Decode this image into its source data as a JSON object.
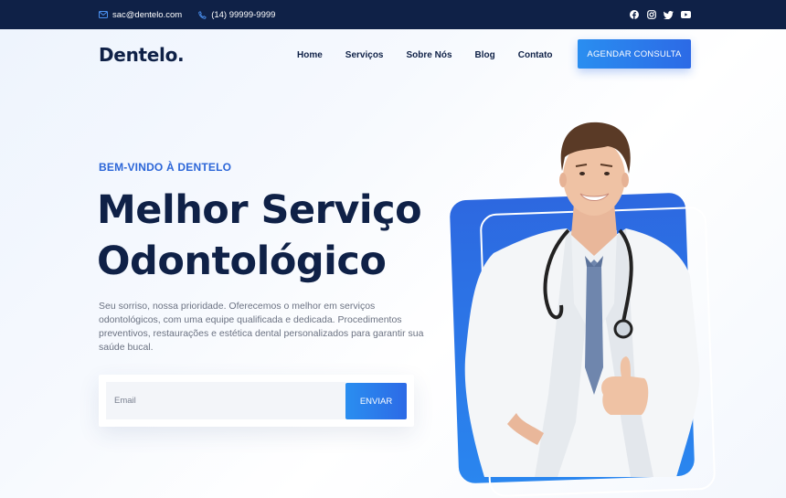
{
  "topbar": {
    "email": "sac@dentelo.com",
    "phone": "(14) 99999-9999",
    "socials": [
      "facebook-icon",
      "instagram-icon",
      "twitter-icon",
      "youtube-icon"
    ]
  },
  "nav": {
    "logo": "Dentelo.",
    "links": [
      "Home",
      "Serviços",
      "Sobre Nós",
      "Blog",
      "Contato"
    ],
    "cta": "AGENDAR CONSULTA"
  },
  "hero": {
    "eyebrow": "BEM-VINDO À DENTELO",
    "title_line1": "Melhor Serviço",
    "title_line2": "Odontológico",
    "description": "Seu sorriso, nossa prioridade. Oferecemos o melhor em serviços odontológicos, com uma equipe qualificada e dedicada. Procedimentos preventivos, restaurações e estética dental personalizados para garantir sua saúde bucal.",
    "email_placeholder": "Email",
    "submit": "ENVIAR"
  },
  "colors": {
    "navy": "#0f2147",
    "accent_blue": "#2c66d8",
    "button_gradient_start": "#2a8ef0",
    "button_gradient_end": "#2c6ae6"
  }
}
